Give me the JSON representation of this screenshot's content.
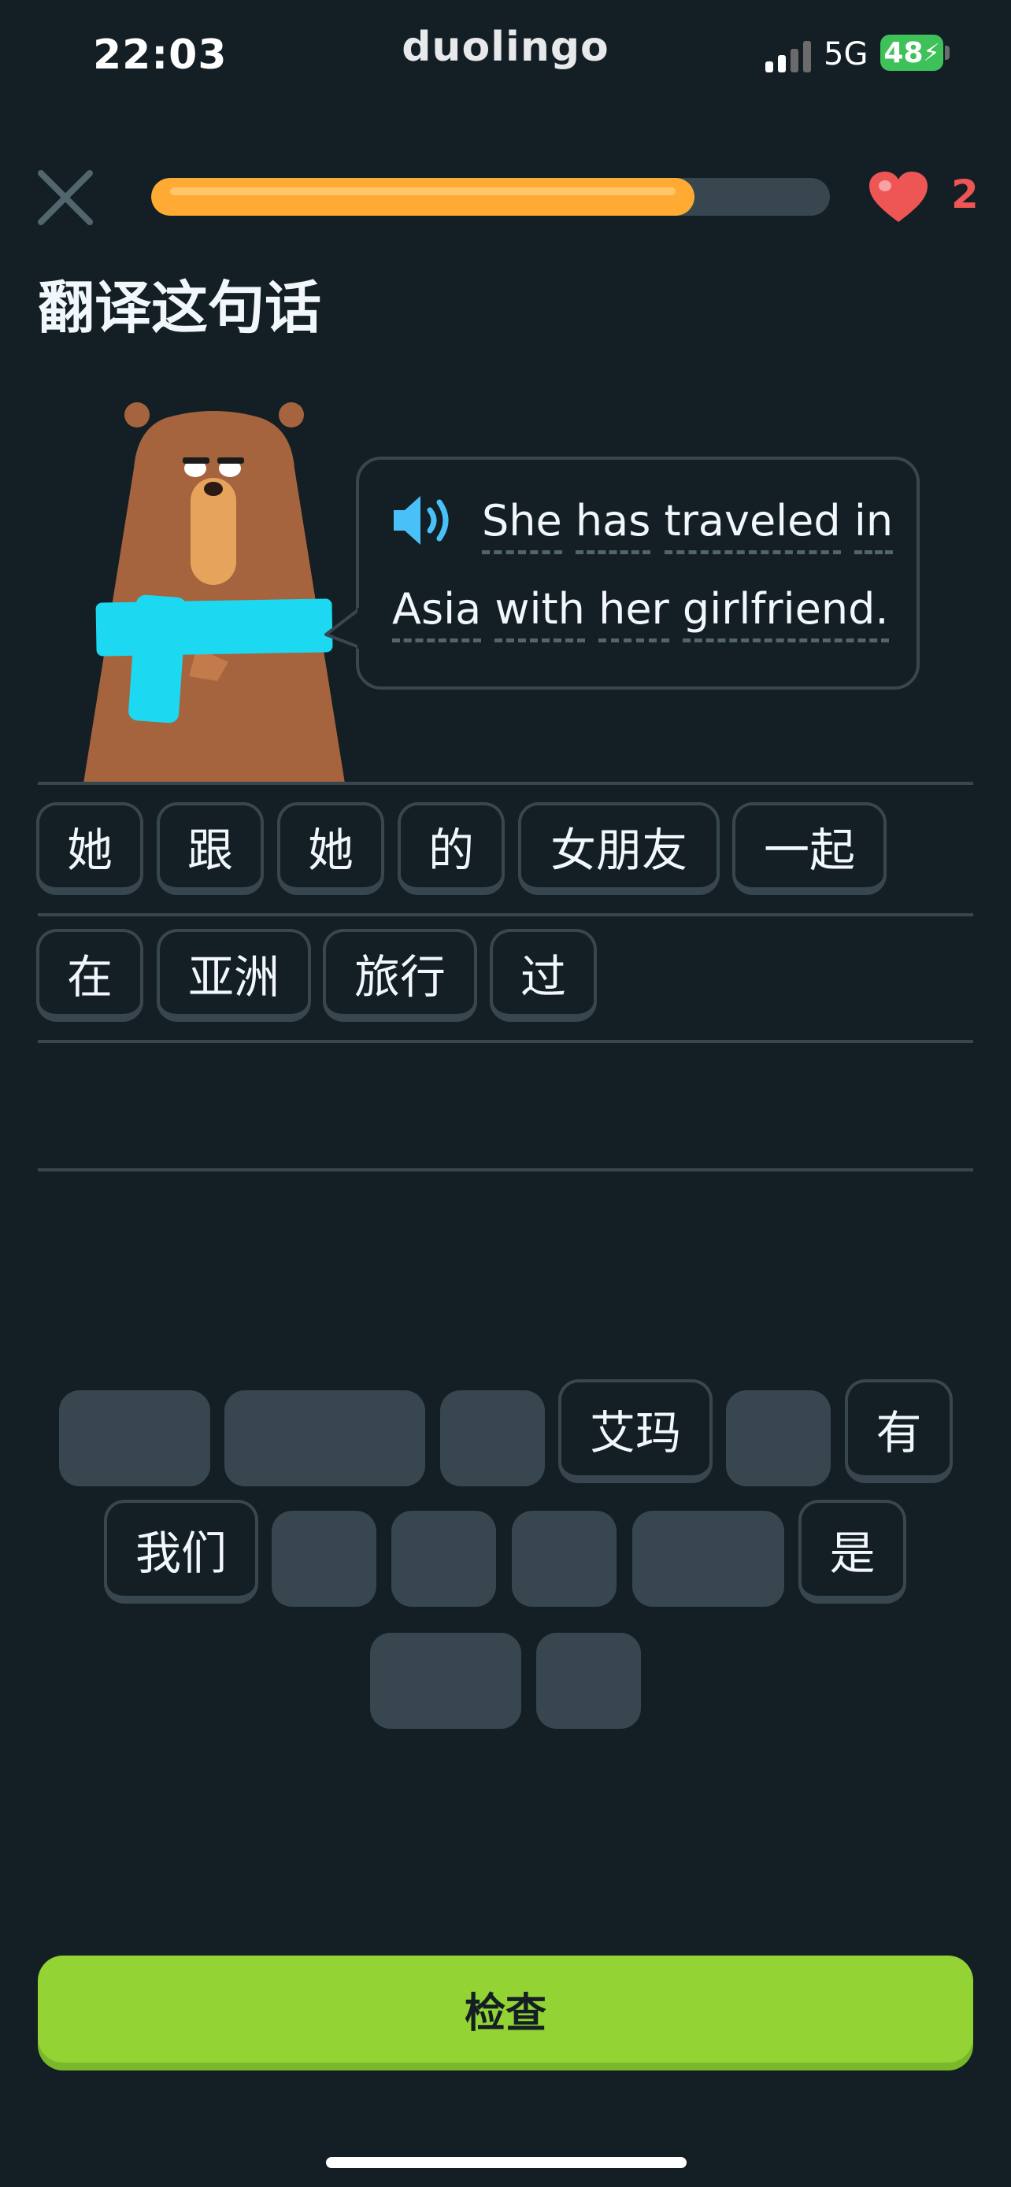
{
  "status_bar": {
    "time": "22:03",
    "brand": "duolingo",
    "network": "5G",
    "battery": "48"
  },
  "lesson": {
    "progress_fraction": 0.8,
    "hearts": "2",
    "title": "翻译这句话"
  },
  "prompt": {
    "line1_words": [
      "She",
      "has",
      "traveled",
      "in"
    ],
    "line2_words": [
      "Asia",
      "with",
      "her",
      "girlfriend."
    ]
  },
  "answer_tiles": [
    [
      "她",
      "跟",
      "她",
      "的",
      "女朋友",
      "一起"
    ],
    [
      "在",
      "亚洲",
      "旅行",
      "过"
    ]
  ],
  "word_bank": [
    "艾玛",
    "有",
    "我们",
    "是"
  ],
  "check_button": "检查",
  "colors": {
    "background": "#131f24",
    "progress": "#ffab33",
    "heart": "#ee5555",
    "check": "#93d333",
    "character_accent": "#1cd8f0",
    "speaker": "#49c0f8"
  }
}
